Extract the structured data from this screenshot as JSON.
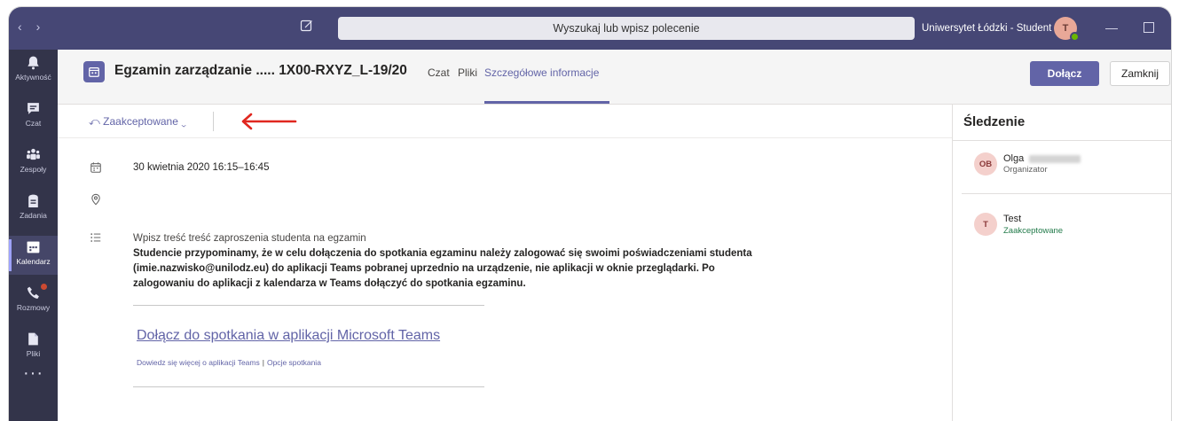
{
  "titlebar": {
    "back": "‹",
    "forward": "›",
    "search_placeholder": "Wyszukaj lub wpisz polecenie",
    "org_switcher": "Uniwersytet Łódzki - Student ⌄",
    "avatar_initial": "T"
  },
  "rail": {
    "items": [
      {
        "label": "Aktywność",
        "icon": "bell-icon"
      },
      {
        "label": "Czat",
        "icon": "chat-icon"
      },
      {
        "label": "Zespoły",
        "icon": "teams-icon"
      },
      {
        "label": "Zadania",
        "icon": "assignments-icon"
      },
      {
        "label": "Kalendarz",
        "icon": "calendar-icon"
      },
      {
        "label": "Rozmowy",
        "icon": "phone-icon"
      },
      {
        "label": "Pliki",
        "icon": "files-icon"
      }
    ],
    "active": "Kalendarz",
    "more": "···"
  },
  "header": {
    "title": "Egzamin zarządzanie ..... 1X00-RXYZ_L-19/20",
    "tabs": [
      "Czat",
      "Pliki",
      "Szczegółowe informacje"
    ],
    "active_tab": "Szczegółowe informacje",
    "join_button": "Dołącz",
    "close_button": "Zamknij"
  },
  "rsvp": {
    "label": "⤺ Zaakceptowane ⌄"
  },
  "details": {
    "datetime": "30 kwietnia 2020 16:15–16:45",
    "location": "",
    "intro": "Wpisz treść treść zaproszenia studenta na egzamin",
    "body": "Studencie przypominamy, że w celu dołączenia do spotkania egzaminu należy zalogować się swoimi poświadczeniami studenta (imie.nazwisko@unilodz.eu) do aplikacji Teams pobranej uprzednio na urządzenie, nie aplikacji w oknie przeglądarki. Po zalogowaniu do aplikacji z kalendarza w Teams dołączyć do spotkania egzaminu.",
    "join_link": "Dołącz do spotkania w aplikacji Microsoft Teams",
    "learn_more": "Dowiedz się więcej o aplikacji Teams",
    "separator": "|",
    "meeting_options": "Opcje spotkania"
  },
  "tracking": {
    "title": "Śledzenie",
    "attendees": [
      {
        "initials": "OB",
        "name": "Olga",
        "role": "Organizator",
        "role_color": "#616161"
      },
      {
        "initials": "T",
        "name": "Test",
        "role": "Zaakceptowane",
        "role_color": "#237b4b"
      }
    ]
  },
  "colors": {
    "accent": "#6264a7",
    "titlebar": "#464775",
    "rail": "#33344a",
    "annotation_arrow": "#e0271f"
  }
}
